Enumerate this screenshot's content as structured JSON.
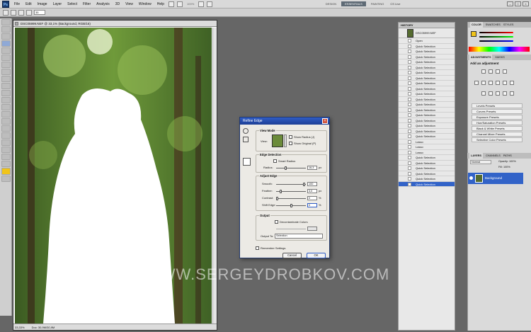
{
  "menubar": {
    "logo": "Ps",
    "items": [
      "File",
      "Edit",
      "Image",
      "Layer",
      "Select",
      "Filter",
      "Analysis",
      "3D",
      "View",
      "Window",
      "Help"
    ],
    "zoom": "100%",
    "workspaces": [
      "DESIGN",
      "ESSENTIALS",
      "PAINTING"
    ],
    "active_workspace": "ESSENTIALS",
    "cs_live": "CS Live"
  },
  "options": {
    "size_value": "35"
  },
  "document": {
    "title": "DSC05999.NEF @ 33,1% (Background, RGB/16)",
    "zoom": "33,33%",
    "doc_size": "Doc: 30,9M/30,9M"
  },
  "dialog": {
    "title": "Refine Edge",
    "view_mode": {
      "title": "View Mode",
      "view_label": "View:",
      "show_radius": "Show Radius (J)",
      "show_original": "Show Original (P)"
    },
    "edge_detection": {
      "title": "Edge Detection",
      "smart_radius": "Smart Radius",
      "radius_label": "Radius:",
      "radius_value": "16,3",
      "radius_unit": "px"
    },
    "adjust_edge": {
      "title": "Adjust Edge",
      "smooth_label": "Smooth:",
      "smooth_value": "100",
      "feather_label": "Feather:",
      "feather_value": "3,0",
      "feather_unit": "px",
      "contrast_label": "Contrast:",
      "contrast_value": "0",
      "contrast_unit": "%",
      "shift_label": "Shift Edge:",
      "shift_value": "0",
      "shift_unit": "%"
    },
    "output": {
      "title": "Output",
      "decontaminate": "Decontaminate Colors",
      "output_to_label": "Output To:",
      "output_to_value": "Selection"
    },
    "remember": "Remember Settings",
    "cancel": "Cancel",
    "ok": "OK"
  },
  "history": {
    "tabs": [
      "HISTORY",
      "ACTIONS"
    ],
    "snapshot": "DSC05999.NEF",
    "items": [
      "Open",
      "Quick Selection",
      "Quick Selection",
      "Quick Selection",
      "Quick Selection",
      "Quick Selection",
      "Quick Selection",
      "Quick Selection",
      "Quick Selection",
      "Quick Selection",
      "Quick Selection",
      "Quick Selection",
      "Quick Selection",
      "Quick Selection",
      "Quick Selection",
      "Quick Selection",
      "Quick Selection",
      "Quick Selection",
      "Quick Selection",
      "Lasso",
      "Lasso",
      "Lasso",
      "Quick Selection",
      "Quick Selection",
      "Quick Selection",
      "Quick Selection",
      "Quick Selection",
      "Quick Selection"
    ],
    "selected_index": 27
  },
  "color_panel": {
    "tabs": [
      "COLOR",
      "SWATCHES",
      "STYLES"
    ],
    "fg_color": "#f0c419"
  },
  "adjustments": {
    "tabs": [
      "ADJUSTMENTS",
      "MASKS"
    ],
    "heading": "Add an adjustment",
    "presets": [
      "Levels Presets",
      "Curves Presets",
      "Exposure Presets",
      "Hue/Saturation Presets",
      "Black & White Presets",
      "Channel Mixer Presets",
      "Selective Color Presets"
    ]
  },
  "layers": {
    "tabs": [
      "LAYERS",
      "CHANNELS",
      "PATHS"
    ],
    "mode": "Normal",
    "opacity": "Opacity: 100%",
    "fill": "Fill: 100%",
    "layer_name": "Background"
  },
  "watermark": "WWW.SERGEYDROBKOV.COM"
}
